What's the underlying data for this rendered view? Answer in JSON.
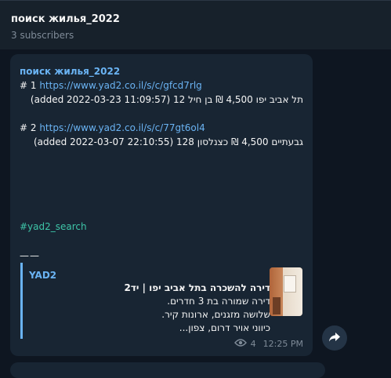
{
  "channel": {
    "title": "поиск жилья_2022",
    "subscribers": "3 subscribers"
  },
  "message": {
    "sender": "поиск жилья_2022",
    "entries": [
      {
        "index_prefix": "# 1 ",
        "link": "https://www.yad2.co.il/s/c/gfcd7rlg",
        "details": "(added 2022-03-23 11:09:57) 12 תל אביב יפו    4,500 ₪ בן חיל"
      },
      {
        "index_prefix": "# 2 ",
        "link": "https://www.yad2.co.il/s/c/77gt6ol4",
        "details": "(added 2022-03-07 22:10:55) 128 גבעתיים    4,500 ₪ כצנלסון"
      }
    ],
    "hashtag": "#yad2_search",
    "divider": "——",
    "preview": {
      "site": "YAD2",
      "title": "דירה להשכרה בתל אביב יפו | יד2",
      "lines": [
        "דירה שמורה בת 3 חדרים.",
        "שלושה מזגנים, ארונות קיר.",
        "כיווני אויר דרום, צפון..."
      ]
    },
    "views": "4",
    "time": "12:25 PM"
  },
  "icons": {
    "views": "eye-icon",
    "share": "share-arrow-icon"
  }
}
